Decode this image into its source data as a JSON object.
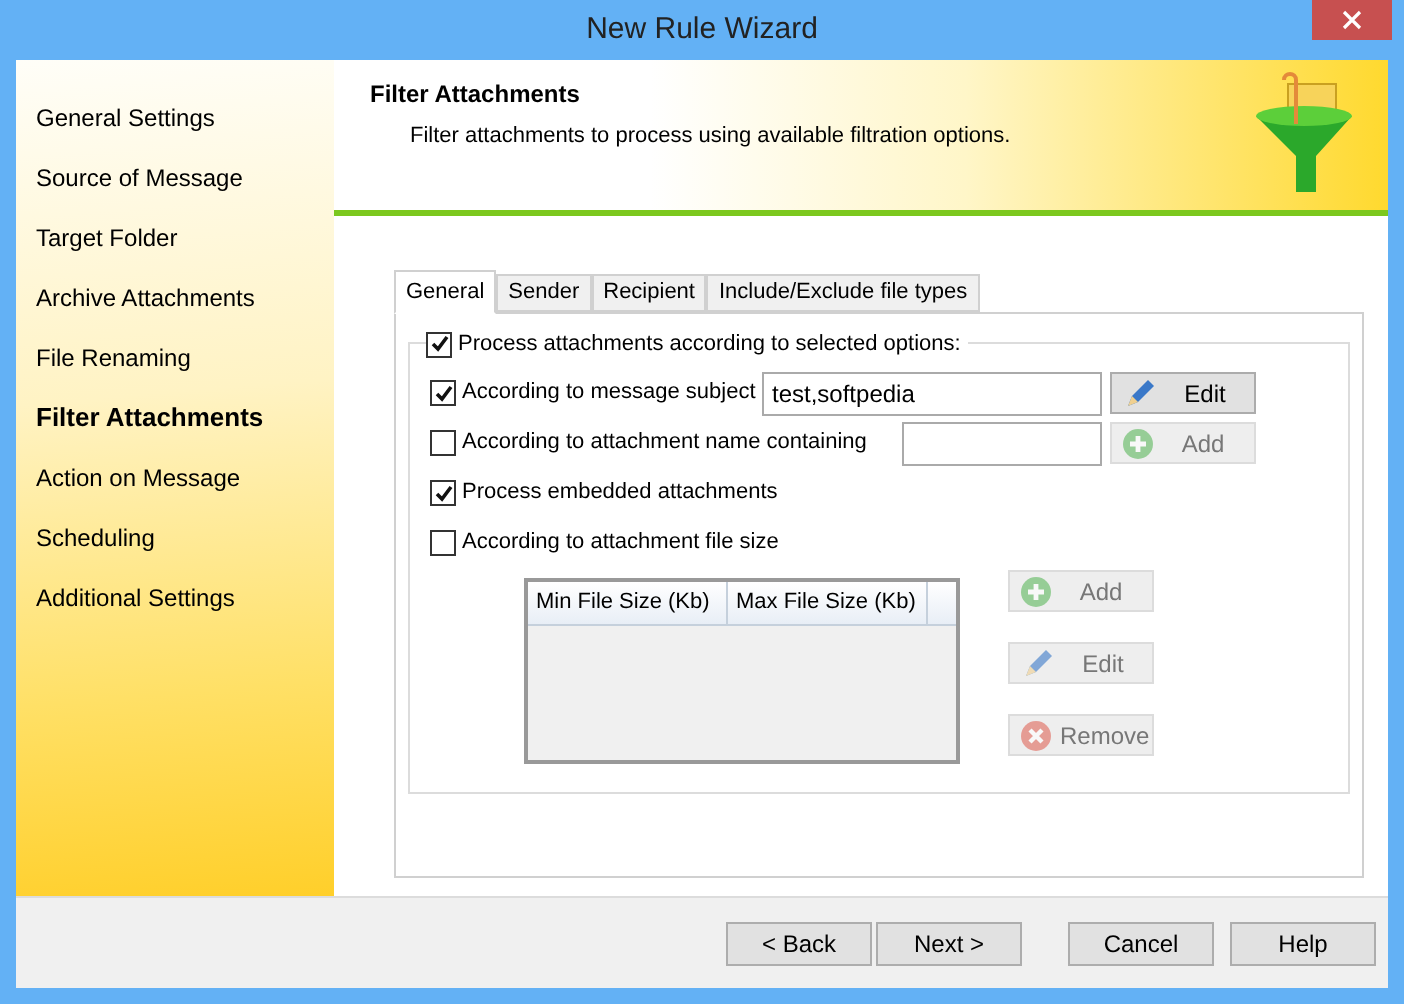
{
  "window": {
    "title": "New Rule Wizard"
  },
  "sidebar": {
    "items": [
      {
        "label": "General Settings",
        "selected": false
      },
      {
        "label": "Source of Message",
        "selected": false
      },
      {
        "label": "Target Folder",
        "selected": false
      },
      {
        "label": "Archive Attachments",
        "selected": false
      },
      {
        "label": "File Renaming",
        "selected": false
      },
      {
        "label": "Filter Attachments",
        "selected": true
      },
      {
        "label": "Action on Message",
        "selected": false
      },
      {
        "label": "Scheduling",
        "selected": false
      },
      {
        "label": "Additional Settings",
        "selected": false
      }
    ]
  },
  "header": {
    "title": "Filter Attachments",
    "subtitle": "Filter attachments to process using available filtration options."
  },
  "tabs": [
    {
      "label": "General",
      "selected": true
    },
    {
      "label": "Sender",
      "selected": false
    },
    {
      "label": "Recipient",
      "selected": false
    },
    {
      "label": "Include/Exclude file types",
      "selected": false
    }
  ],
  "group": {
    "label": "Process attachments according to selected options:",
    "checked": true
  },
  "options": [
    {
      "label": "According to message  subject",
      "checked": true,
      "kind": "field",
      "field": {
        "value": "test,softpedia"
      },
      "button": {
        "label": "Edit",
        "kind": "edit",
        "disabled": false
      }
    },
    {
      "label": "According to attachment name containing",
      "checked": false,
      "kind": "field",
      "button": {
        "label": "Add",
        "kind": "add",
        "disabled": true
      }
    },
    {
      "label": "Process embedded attachments",
      "checked": true
    },
    {
      "label": "According to attachment file size",
      "checked": false
    }
  ],
  "size_table": {
    "columns": [
      "Min File Size (Kb)",
      "Max File Size (Kb)"
    ]
  },
  "size_buttons": [
    {
      "label": "Add",
      "kind": "add",
      "disabled": true
    },
    {
      "label": "Edit",
      "kind": "edit",
      "disabled": true
    },
    {
      "label": "Remove",
      "kind": "remove",
      "disabled": true
    }
  ],
  "footer_buttons": [
    {
      "label": "< Back"
    },
    {
      "label": "Next >"
    },
    {
      "label": "Cancel"
    },
    {
      "label": "Help"
    }
  ]
}
